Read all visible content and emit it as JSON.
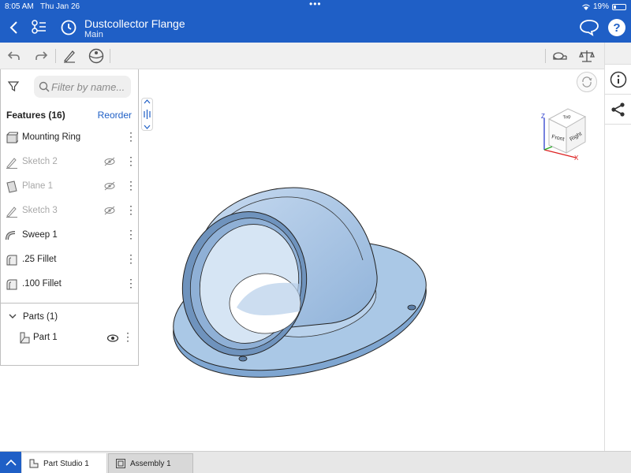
{
  "status_bar": {
    "time": "8:05 AM",
    "date": "Thu Jan 26",
    "battery": "19%"
  },
  "header": {
    "title": "Dustcollector Flange",
    "branch": "Main"
  },
  "features_panel": {
    "search_placeholder": "Filter by name...",
    "heading": "Features (16)",
    "reorder_label": "Reorder",
    "items": [
      {
        "label": "Mounting Ring",
        "icon": "extrude-icon",
        "hidden": false
      },
      {
        "label": "Sketch 2",
        "icon": "sketch-icon",
        "hidden": true
      },
      {
        "label": "Plane 1",
        "icon": "plane-icon",
        "hidden": true
      },
      {
        "label": "Sketch 3",
        "icon": "sketch-icon",
        "hidden": true
      },
      {
        "label": "Sweep 1",
        "icon": "sweep-icon",
        "hidden": false
      },
      {
        "label": ".25 Fillet",
        "icon": "fillet-icon",
        "hidden": false
      },
      {
        "label": ".100 Fillet",
        "icon": "fillet-icon",
        "hidden": false
      }
    ],
    "parts_heading": "Parts (1)",
    "parts": [
      {
        "label": "Part 1"
      }
    ]
  },
  "viewcube": {
    "top": "Top",
    "front": "Front",
    "right": "Right",
    "axis_z": "Z",
    "axis_x": "X"
  },
  "tabs": [
    {
      "label": "Part Studio 1",
      "active": true
    },
    {
      "label": "Assembly 1",
      "active": false
    }
  ],
  "colors": {
    "brand_blue": "#1f5fc6",
    "model_blue": "#a9c7e6"
  }
}
